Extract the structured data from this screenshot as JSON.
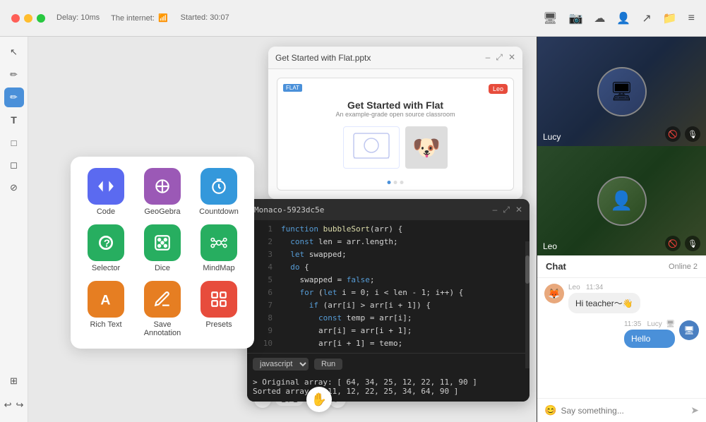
{
  "titlebar": {
    "delay_label": "Delay: 10ms",
    "internet_label": "The internet:",
    "started_label": "Started: 30:07"
  },
  "tools_panel": {
    "items": [
      {
        "id": "code",
        "label": "Code",
        "bg": "#5b6af0",
        "icon": "▶"
      },
      {
        "id": "geogebra",
        "label": "GeoGebra",
        "bg": "#9b59b6",
        "icon": "⊕"
      },
      {
        "id": "countdown",
        "label": "Countdown",
        "bg": "#3498db",
        "icon": "⏱"
      },
      {
        "id": "selector",
        "label": "Selector",
        "bg": "#27ae60",
        "icon": "?"
      },
      {
        "id": "dice",
        "label": "Dice",
        "bg": "#27ae60",
        "icon": "⚄"
      },
      {
        "id": "mindmap",
        "label": "MindMap",
        "bg": "#27ae60",
        "icon": "⊙"
      },
      {
        "id": "richtext",
        "label": "Rich Text",
        "bg": "#e67e22",
        "icon": "A"
      },
      {
        "id": "saveannotation",
        "label": "Save Annotation",
        "bg": "#e67e22",
        "icon": "✎"
      },
      {
        "id": "presets",
        "label": "Presets",
        "bg": "#e74c3c",
        "icon": "⊞"
      }
    ]
  },
  "presentation": {
    "window_title": "Get Started with Flat.pptx",
    "slide_title": "Get Started with Flat",
    "slide_subtitle": "An example-grade open source classroom",
    "leo_badge": "Leo"
  },
  "code_editor": {
    "title": "Monaco-5923dc5e",
    "language": "javascript",
    "run_button": "Run",
    "lines": [
      {
        "num": 1,
        "code": "function bubbleSort(arr) {"
      },
      {
        "num": 2,
        "code": "  const len = arr.length;"
      },
      {
        "num": 3,
        "code": "  let swapped;"
      },
      {
        "num": 4,
        "code": "  do {"
      },
      {
        "num": 5,
        "code": "    swapped = false;"
      },
      {
        "num": 6,
        "code": "    for (let i = 0; i < len - 1; i++) {"
      },
      {
        "num": 7,
        "code": "      if (arr[i] > arr[i + 1]) {"
      },
      {
        "num": 8,
        "code": "        const temp = arr[i];"
      },
      {
        "num": 9,
        "code": "        arr[i] = arr[i + 1];"
      },
      {
        "num": 10,
        "code": "        arr[i + 1] = temo;"
      }
    ],
    "output_line1": "> Original array: [ 64, 34, 25, 12, 22, 11, 90 ]",
    "output_line2": "  Sorted array:   [ 11, 12, 22, 25, 34, 64, 90 ]"
  },
  "page_nav": {
    "current": "1",
    "total": "1",
    "separator": "/",
    "total_pages": "/ 12"
  },
  "video_panel": {
    "users": [
      {
        "name": "Lucy",
        "emoji": "🖥"
      },
      {
        "name": "Leo",
        "emoji": "👤"
      }
    ]
  },
  "chat": {
    "title": "Chat",
    "online_text": "Online 2",
    "messages": [
      {
        "sender": "Leo",
        "time": "11:34",
        "text": "Hi teacher～👋",
        "side": "left"
      },
      {
        "sender": "Lucy",
        "time": "11:35",
        "text": "Hello",
        "side": "right"
      }
    ],
    "input_placeholder": "Say something..."
  }
}
